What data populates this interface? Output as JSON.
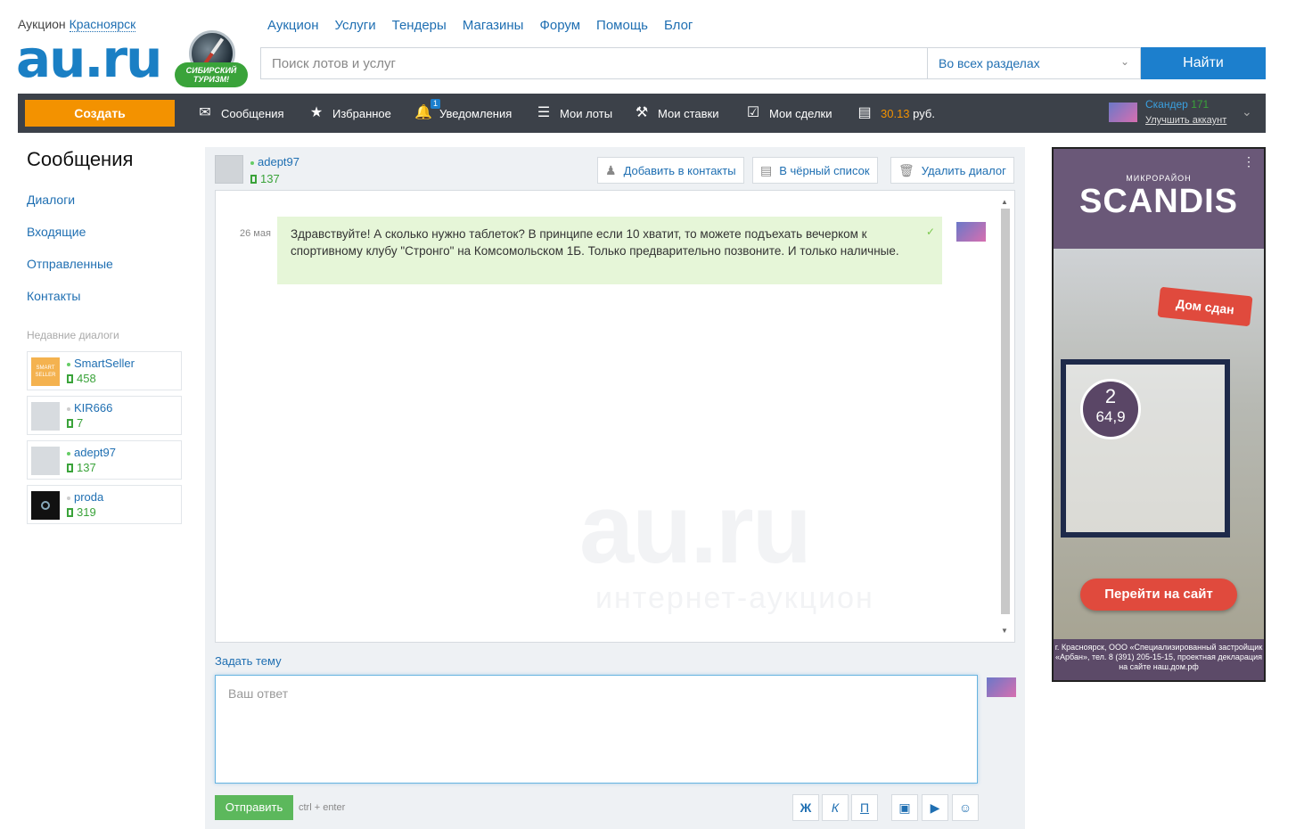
{
  "header": {
    "city_prefix": "Аукцион",
    "city": "Красноярск",
    "logo": "au.ru",
    "badge_text": "СИБИРСКИЙ ТУРИЗМ!",
    "nav": [
      "Аукцион",
      "Услуги",
      "Тендеры",
      "Магазины",
      "Форум",
      "Помощь",
      "Блог"
    ],
    "search_placeholder": "Поиск лотов и услуг",
    "search_section": "Во всех разделах",
    "search_button": "Найти"
  },
  "toolbar": {
    "create": "Создать",
    "messages": "Сообщения",
    "favorites": "Избранное",
    "notifications": "Уведомления",
    "notifications_count": "1",
    "my_lots": "Мои лоты",
    "my_bids": "Мои ставки",
    "my_deals": "Мои сделки",
    "balance": "30.13",
    "currency": "руб.",
    "account_name": "Скандер",
    "account_rating": "171",
    "upgrade": "Улучшить аккаунт"
  },
  "sidebar": {
    "title": "Сообщения",
    "links": [
      "Диалоги",
      "Входящие",
      "Отправленные",
      "Контакты"
    ],
    "recent_header": "Недавние диалоги",
    "recent": [
      {
        "name": "SmartSeller",
        "rating": "458",
        "avatar_text": "SMART SELLER"
      },
      {
        "name": "KIR666",
        "rating": "7"
      },
      {
        "name": "adept97",
        "rating": "137"
      },
      {
        "name": "proda",
        "rating": "319"
      }
    ]
  },
  "dialog": {
    "user": "adept97",
    "rating": "137",
    "actions": {
      "add_contact": "Добавить в контакты",
      "blacklist": "В чёрный список",
      "delete": "Удалить диалог"
    },
    "message": {
      "date": "26 мая",
      "text": "Здравствуйте! А сколько нужно таблеток? В принципе если 10 хватит, то можете подъехать вечерком к спортивному клубу \"Стронго\" на Комсомольском 1Б. Только предварительно позвоните. И только наличные."
    },
    "watermark": "au.ru",
    "watermark_sub": "интернет-аукцион",
    "topic_link": "Задать тему",
    "reply_placeholder": "Ваш ответ",
    "send": "Отправить",
    "send_hint": "ctrl + enter",
    "format": {
      "bold": "Ж",
      "italic": "К",
      "underline": "П"
    }
  },
  "ad": {
    "sub": "МИКРОРАЙОН",
    "brand": "SCANDIS",
    "tag": "Дом сдан",
    "rooms": "2",
    "area": "64,9",
    "cta": "Перейти на сайт",
    "legal": "г. Красноярск, ООО «Специализированный застройщик «Арбан», тел. 8 (391) 205-15-15, проектная декларация на сайте наш.дом.рф"
  },
  "colors": {
    "brand_blue": "#1a7fc4",
    "toolbar_bg": "#3c4149",
    "create_orange": "#f39200",
    "send_green": "#5cb85c",
    "message_bg": "#e6f6d8"
  }
}
